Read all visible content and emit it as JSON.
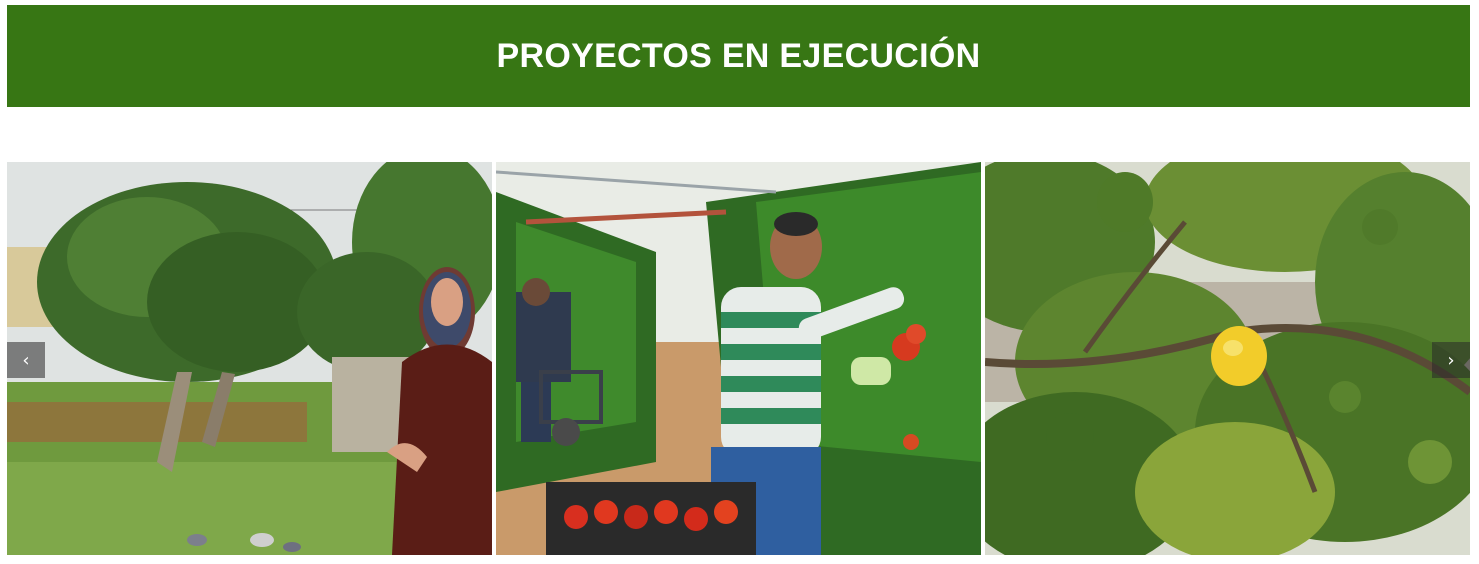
{
  "header": {
    "title": "PROYECTOS EN EJECUCIÓN",
    "background_color": "#377614"
  },
  "carousel": {
    "prev_icon": "chevron-left-icon",
    "next_icon": "chevron-right-icon",
    "prev_glyph": "‹",
    "next_glyph": "›",
    "slides": [
      {
        "subject": "woman-orchard-photo"
      },
      {
        "subject": "tomato-greenhouse-photo"
      },
      {
        "subject": "citrus-tree-photo"
      }
    ]
  }
}
